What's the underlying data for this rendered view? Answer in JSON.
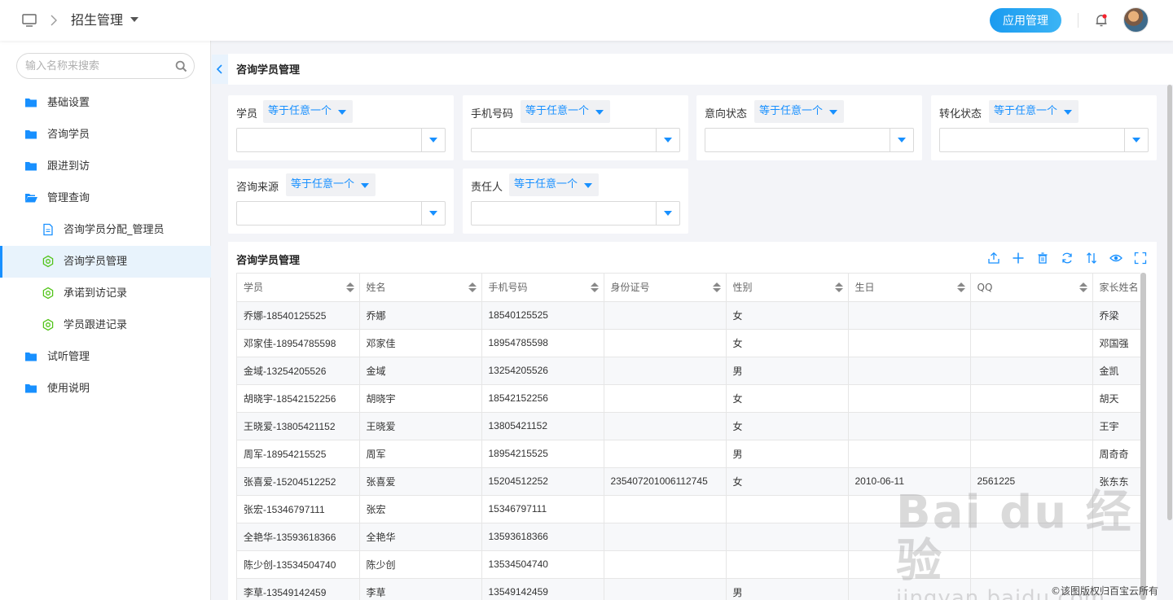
{
  "header": {
    "title": "招生管理",
    "app_button": "应用管理",
    "accent": "#1a9bf0"
  },
  "sidebar": {
    "search_placeholder": "输入名称来搜索",
    "items": [
      {
        "label": "基础设置",
        "icon": "folder-icon",
        "level": 1
      },
      {
        "label": "咨询学员",
        "icon": "folder-icon",
        "level": 1
      },
      {
        "label": "跟进到访",
        "icon": "folder-icon",
        "level": 1
      },
      {
        "label": "管理查询",
        "icon": "folder-open-icon",
        "level": 1
      },
      {
        "label": "咨询学员分配_管理员",
        "icon": "document-icon",
        "level": 2
      },
      {
        "label": "咨询学员管理",
        "icon": "gear-icon",
        "level": 2,
        "active": true
      },
      {
        "label": "承诺到访记录",
        "icon": "gear-icon",
        "level": 2
      },
      {
        "label": "学员跟进记录",
        "icon": "gear-icon",
        "level": 2
      },
      {
        "label": "试听管理",
        "icon": "folder-icon",
        "level": 1
      },
      {
        "label": "使用说明",
        "icon": "folder-icon",
        "level": 1
      }
    ]
  },
  "page": {
    "title": "咨询学员管理"
  },
  "filters": [
    {
      "label": "学员",
      "operator": "等于任意一个"
    },
    {
      "label": "手机号码",
      "operator": "等于任意一个"
    },
    {
      "label": "意向状态",
      "operator": "等于任意一个"
    },
    {
      "label": "转化状态",
      "operator": "等于任意一个"
    },
    {
      "label": "咨询来源",
      "operator": "等于任意一个"
    },
    {
      "label": "责任人",
      "operator": "等于任意一个"
    }
  ],
  "table": {
    "title": "咨询学员管理",
    "toolbar": [
      "upload-icon",
      "plus-icon",
      "delete-icon",
      "refresh-icon",
      "sort-icon",
      "eye-icon",
      "fullscreen-icon"
    ],
    "columns": [
      "学员",
      "姓名",
      "手机号码",
      "身份证号",
      "性别",
      "生日",
      "QQ",
      "家长姓名"
    ],
    "rows": [
      [
        "乔娜-18540125525",
        "乔娜",
        "18540125525",
        "",
        "女",
        "",
        "",
        "乔梁"
      ],
      [
        "邓家佳-18954785598",
        "邓家佳",
        "18954785598",
        "",
        "女",
        "",
        "",
        "邓国强"
      ],
      [
        "金域-13254205526",
        "金域",
        "13254205526",
        "",
        "男",
        "",
        "",
        "金凯"
      ],
      [
        "胡晓宇-18542152256",
        "胡晓宇",
        "18542152256",
        "",
        "女",
        "",
        "",
        "胡天"
      ],
      [
        "王晓爱-13805421152",
        "王晓爱",
        "13805421152",
        "",
        "女",
        "",
        "",
        "王宇"
      ],
      [
        "周军-18954215525",
        "周军",
        "18954215525",
        "",
        "男",
        "",
        "",
        "周奇奇"
      ],
      [
        "张喜爱-15204512252",
        "张喜爱",
        "15204512252",
        "235407201006112745",
        "女",
        "2010-06-11",
        "2561225",
        "张东东"
      ],
      [
        "张宏-15346797111",
        "张宏",
        "15346797111",
        "",
        "",
        "",
        "",
        ""
      ],
      [
        "全艳华-13593618366",
        "全艳华",
        "13593618366",
        "",
        "",
        "",
        "",
        ""
      ],
      [
        "陈少创-13534504740",
        "陈少创",
        "13534504740",
        "",
        "",
        "",
        "",
        ""
      ],
      [
        "李草-13549142459",
        "李草",
        "13549142459",
        "",
        "男",
        "",
        "",
        ""
      ]
    ]
  },
  "watermark": {
    "main": "Bai du 经验",
    "sub": "jingyan.baidu.com"
  },
  "copyright": "©该图版权归百宝云所有"
}
